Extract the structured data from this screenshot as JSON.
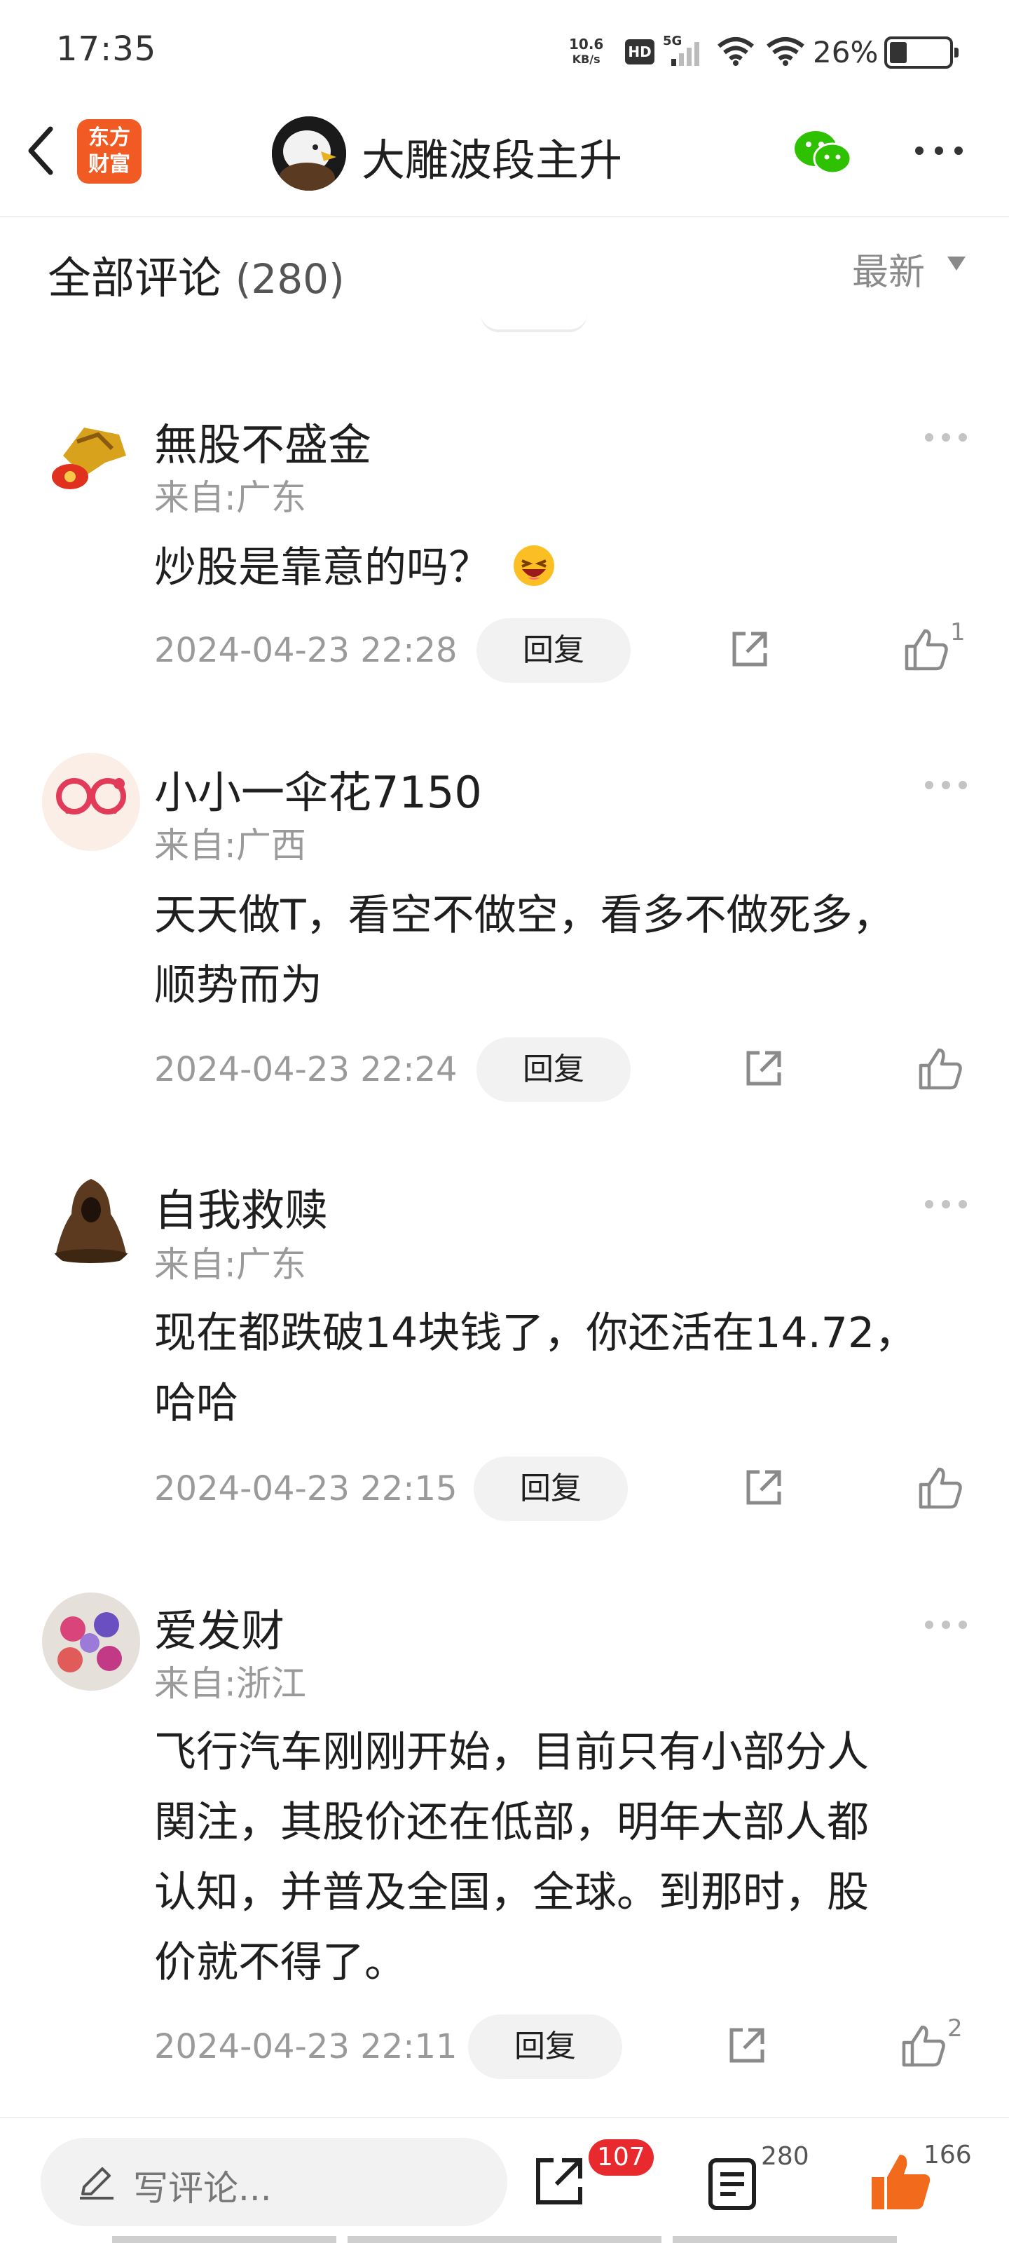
{
  "status_bar": {
    "time": "17:35",
    "net_speed": "10.6",
    "net_unit": "KB/s",
    "hd": "HD",
    "network": "5G",
    "battery": "26%"
  },
  "header": {
    "logo_text_1": "东方",
    "logo_text_2": "财富",
    "title": "大雕波段主升"
  },
  "comments_header": {
    "title": "全部评论",
    "count": "(280)",
    "sort": "最新"
  },
  "comments": [
    {
      "user": "無股不盛金",
      "from": "来自:广东",
      "text": "炒股是靠意的吗？",
      "emoji": "😆",
      "date": "2024-04-23 22:28",
      "reply": "回复",
      "likes": "1"
    },
    {
      "user": "小小一伞花7150",
      "from": "来自:广西",
      "text_lines": [
        "天天做T，看空不做空，看多不做死多，",
        "顺势而为"
      ],
      "date": "2024-04-23 22:24",
      "reply": "回复",
      "likes": ""
    },
    {
      "user": "自我救赎",
      "from": "来自:广东",
      "text_lines": [
        "现在都跌破14块钱了，你还活在14.72，",
        "哈哈"
      ],
      "date": "2024-04-23 22:15",
      "reply": "回复",
      "likes": ""
    },
    {
      "user": "爱发财",
      "from": "来自:浙江",
      "text_lines": [
        "飞行汽车刚刚开始，目前只有小部分人",
        "関注，其股价还在低部，明年大部人都",
        "认知，并普及全国，全球。到那时，股",
        "价就不得了。"
      ],
      "date": "2024-04-23 22:11",
      "reply": "回复",
      "likes": "2"
    }
  ],
  "bottom_bar": {
    "input_placeholder": "写评论...",
    "share_badge": "107",
    "comment_count": "280",
    "like_count": "166"
  },
  "colors": {
    "accent_orange": "#f15a22",
    "badge_red": "#e8292e",
    "wechat_green": "#2dc100",
    "muted_text": "#9a9a9a"
  }
}
